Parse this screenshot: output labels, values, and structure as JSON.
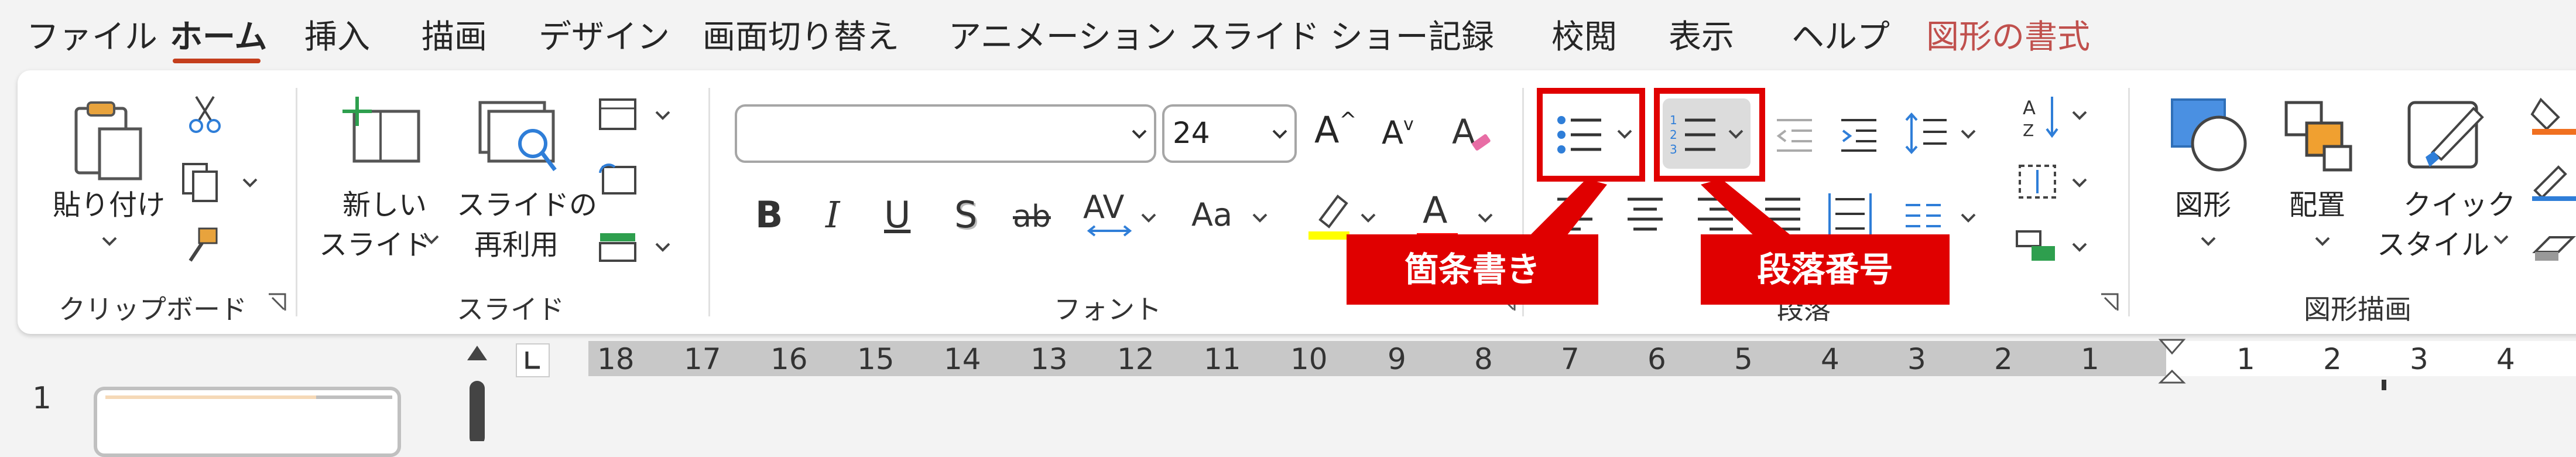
{
  "tabs": [
    {
      "label": "ファイル"
    },
    {
      "label": "ホーム"
    },
    {
      "label": "挿入"
    },
    {
      "label": "描画"
    },
    {
      "label": "デザイン"
    },
    {
      "label": "画面切り替え"
    },
    {
      "label": "アニメーション"
    },
    {
      "label": "スライド ショー"
    },
    {
      "label": "記録"
    },
    {
      "label": "校閲"
    },
    {
      "label": "表示"
    },
    {
      "label": "ヘルプ"
    },
    {
      "label": "図形の書式"
    }
  ],
  "groups": {
    "clipboard": {
      "label": "クリップボード",
      "paste_line1": "貼り付け"
    },
    "slides": {
      "label": "スライド",
      "new_slide_line1": "新しい",
      "new_slide_line2": "スライド",
      "reuse_line1": "スライドの",
      "reuse_line2": "再利用"
    },
    "font": {
      "label": "フォント",
      "font_name": "",
      "font_size": "24",
      "bold": "B",
      "italic": "I",
      "underline": "U",
      "shadow": "S",
      "strike": "ab",
      "spacing": "AV",
      "case": "Aa",
      "font_color_glyph": "A",
      "grow": "A",
      "shrink": "A"
    },
    "paragraph": {
      "label": "段落"
    },
    "drawing": {
      "label": "図形描画",
      "shapes": "図形",
      "arrange": "配置",
      "quick_line1": "クイック",
      "quick_line2": "スタイル"
    }
  },
  "callouts": {
    "bullets": "箇条書き",
    "numbering": "段落番号"
  },
  "ruler": {
    "numbers": [
      "18",
      "17",
      "16",
      "15",
      "14",
      "13",
      "12",
      "11",
      "10",
      "9",
      "8",
      "7",
      "6",
      "5",
      "4",
      "3",
      "2",
      "1",
      "1",
      "2",
      "3",
      "4"
    ]
  },
  "thumbnail": {
    "number": "1"
  },
  "colors": {
    "accent": "#c43e1c",
    "callout": "#e00000",
    "highlight": "#ffff00",
    "font_color": "#ff0000"
  }
}
